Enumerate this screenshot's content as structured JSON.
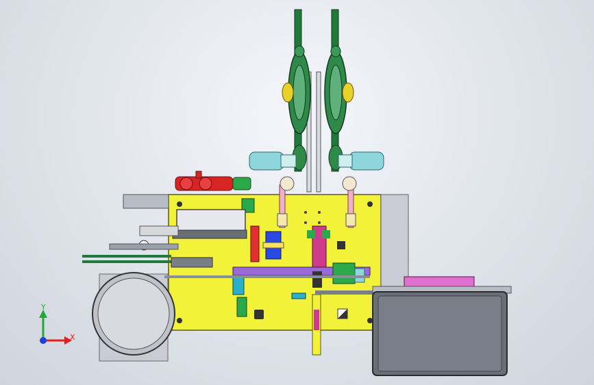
{
  "triad": {
    "y_label": "Y",
    "x_label": "X",
    "y_color": "#1faa3a",
    "x_color": "#e02020",
    "z_color": "#1f3fd8"
  },
  "colors": {
    "plate": "#f2f23a",
    "plate_edge": "#5a5a1e",
    "belt": "#1f7a3a",
    "cyan": "#8fd6dc",
    "red": "#d92424",
    "purple": "#9a6ad8",
    "pink": "#e070d0",
    "grey": "#9aa0aa",
    "dark": "#3a3a3a"
  }
}
